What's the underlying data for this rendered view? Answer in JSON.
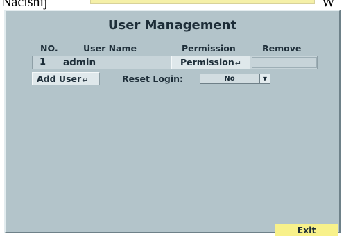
{
  "document": {
    "word_left": "Naciśnij",
    "word_right": "W"
  },
  "screen": {
    "title": "User Management",
    "columns": {
      "no": "NO.",
      "user_name": "User Name",
      "permission": "Permission",
      "remove": "Remove"
    },
    "users": [
      {
        "no": "1",
        "name": "admin",
        "permission_label": "Permission",
        "remove": ""
      }
    ],
    "enter_glyph": "↵",
    "add_user_label": "Add User",
    "reset_login": {
      "label": "Reset Login:",
      "value": "No"
    },
    "dropdown_glyph": "▼",
    "exit_label": "Exit",
    "colors": {
      "background": "#b3c4ca",
      "text": "#1d2d38",
      "exit_button": "#f8f18a"
    }
  }
}
